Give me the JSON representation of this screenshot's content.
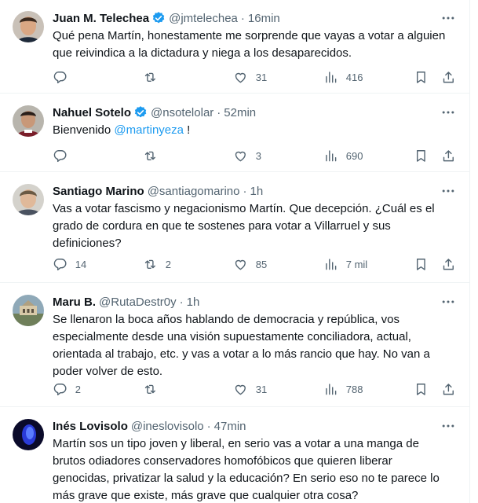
{
  "tweets": [
    {
      "name": "Juan M. Telechea",
      "verified": true,
      "handle": "@jmtelechea",
      "time": "16min",
      "text_lines": [
        "Qué pena Martín, honestamente me sorprende que vayas a votar a alguien",
        "que reivindica a la dictadura y niega a los desaparecidos."
      ],
      "replies": "",
      "retweets": "",
      "likes": "31",
      "views": "416"
    },
    {
      "name": "Nahuel Sotelo",
      "verified": true,
      "handle": "@nsotelolar",
      "time": "52min",
      "text_prefix": "Bienvenido ",
      "mention": "@martinyeza",
      "text_suffix": " !",
      "replies": "",
      "retweets": "",
      "likes": "3",
      "views": "690"
    },
    {
      "name": "Santiago Marino",
      "verified": false,
      "handle": "@santiagomarino",
      "time": "1h",
      "text_lines": [
        "Vas a votar fascismo y negacionismo Martín. Que decepción. ¿Cuál es el",
        "grado de cordura en que te sostenes para votar a Villarruel y sus",
        "definiciones?"
      ],
      "replies": "14",
      "retweets": "2",
      "likes": "85",
      "views": "7 mil"
    },
    {
      "name": "Maru B.",
      "verified": false,
      "handle": "@RutaDestr0y",
      "time": "1h",
      "text_lines": [
        "Se llenaron la boca años hablando de democracia y república, vos",
        "especialmente desde una visión supuestamente conciliadora, actual,",
        "orientada al trabajo, etc. y vas a votar a lo más rancio que hay. No van a",
        "poder volver de esto."
      ],
      "replies": "2",
      "retweets": "",
      "likes": "31",
      "views": "788"
    },
    {
      "name": "Inés Lovisolo",
      "verified": false,
      "handle": "@ineslovisolo",
      "time": "47min",
      "text_lines": [
        "Martín sos un tipo joven y liberal, en serio vas a votar a una manga de",
        "brutos odiadores conservadores homofóbicos que quieren liberar",
        "genocidas, privatizar la salud y la educación? En serio eso no te parece lo",
        "más grave que existe, más grave que cualquier otra cosa?"
      ]
    }
  ],
  "separator": "·",
  "icons": {
    "reply": "reply-icon",
    "retweet": "retweet-icon",
    "like": "heart-icon",
    "views": "views-icon",
    "bookmark": "bookmark-icon",
    "share": "share-icon",
    "more": "more-icon",
    "verified": "verified-badge-icon"
  },
  "colors": {
    "text": "#0f1419",
    "secondary": "#536471",
    "accent": "#1d9bf0",
    "divider": "#eff3f4"
  }
}
